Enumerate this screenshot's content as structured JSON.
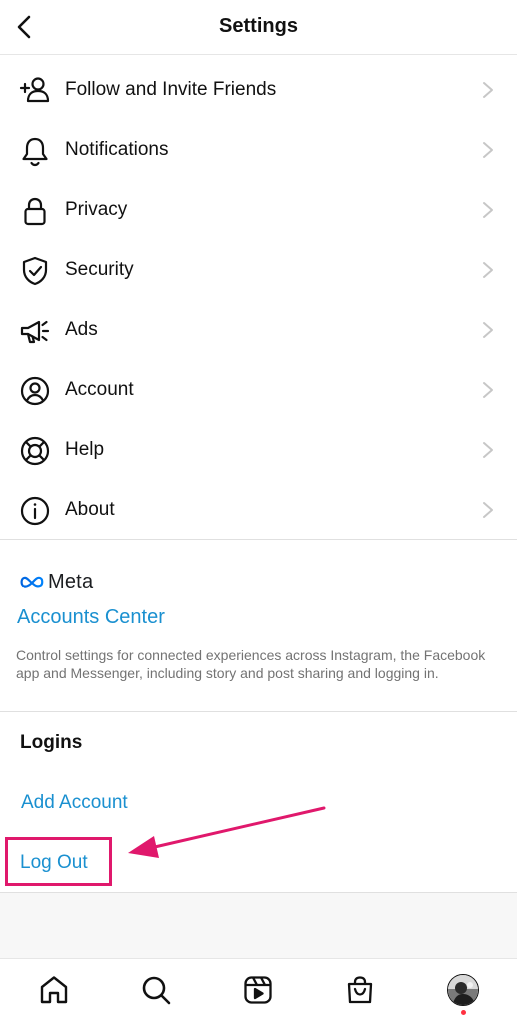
{
  "header": {
    "title": "Settings"
  },
  "menu": {
    "items": [
      {
        "label": "Follow and Invite Friends",
        "icon": "add-person-icon"
      },
      {
        "label": "Notifications",
        "icon": "bell-icon"
      },
      {
        "label": "Privacy",
        "icon": "lock-icon"
      },
      {
        "label": "Security",
        "icon": "shield-check-icon"
      },
      {
        "label": "Ads",
        "icon": "megaphone-icon"
      },
      {
        "label": "Account",
        "icon": "user-circle-icon"
      },
      {
        "label": "Help",
        "icon": "lifebuoy-icon"
      },
      {
        "label": "About",
        "icon": "info-icon"
      }
    ]
  },
  "meta": {
    "logo_text": "Meta",
    "accounts_center_label": "Accounts Center",
    "description": "Control settings for connected experiences across Instagram, the Facebook app and Messenger, including story and post sharing and logging in."
  },
  "logins": {
    "heading": "Logins",
    "add_account_label": "Add Account",
    "logout_label": "Log Out"
  },
  "annotation": {
    "highlight_color": "#e0186c"
  },
  "colors": {
    "link": "#1a90d0",
    "text": "#111111",
    "secondary": "#737373"
  },
  "tabbar": {
    "tabs": [
      "home-icon",
      "search-icon",
      "reels-icon",
      "shop-icon",
      "profile-avatar"
    ]
  }
}
